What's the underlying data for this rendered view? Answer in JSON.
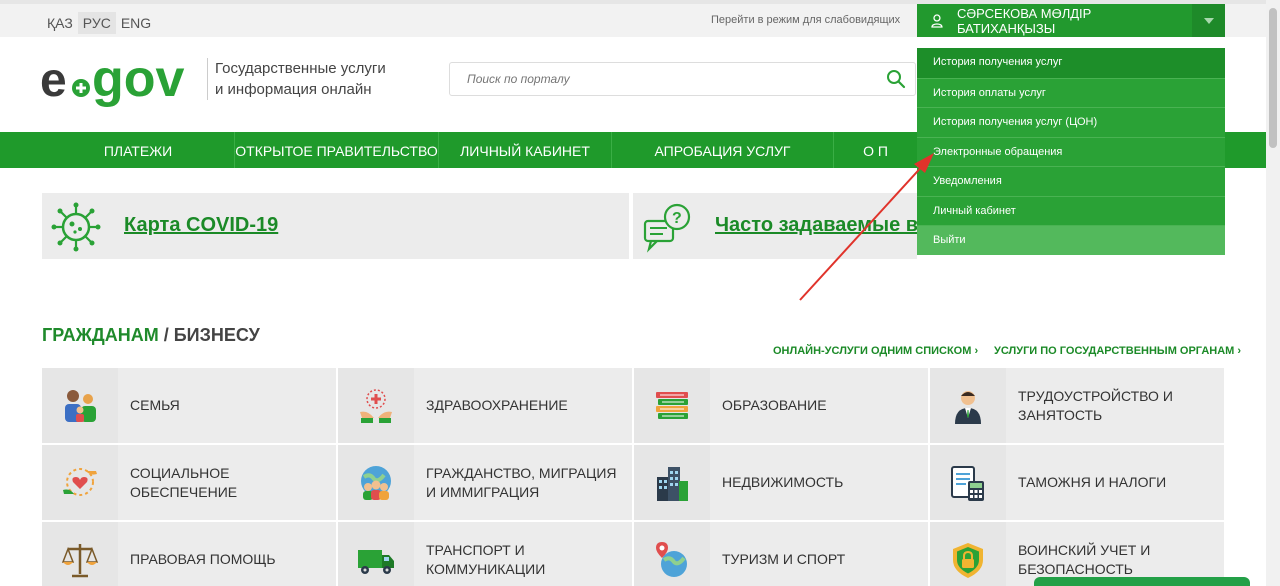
{
  "topbar": {
    "languages": [
      "ҚАЗ",
      "РУС",
      "ENG"
    ],
    "accessibility_link": "Перейти в режим для слабовидящих",
    "user_name": "СӘРСЕКОВА МӨЛДІР БАТИХАНҚЫЗЫ"
  },
  "header": {
    "logo_text": "egov",
    "tagline_line1": "Государственные услуги",
    "tagline_line2": "и информация онлайн",
    "search_placeholder": "Поиск по порталу"
  },
  "nav": {
    "items": [
      "ПЛАТЕЖИ",
      "ОТКРЫТОЕ ПРАВИТЕЛЬСТВО",
      "ЛИЧНЫЙ КАБИНЕТ",
      "АПРОБАЦИЯ УСЛУГ",
      "О П"
    ]
  },
  "banners": {
    "covid": "Карта COVID-19",
    "faq": "Часто задаваемые вопр"
  },
  "user_menu": {
    "items": [
      "История получения услуг",
      "История оплаты услуг",
      "История получения услуг (ЦОН)",
      "Электронные обращения",
      "Уведомления",
      "Личный кабинет",
      "Выйти"
    ]
  },
  "section": {
    "title_citizens": "ГРАЖДАНАМ",
    "title_sep": " / ",
    "title_business": "БИЗНЕСУ",
    "link_list": "ОНЛАЙН-УСЛУГИ ОДНИМ СПИСКОМ ›",
    "link_agencies": "УСЛУГИ ПО ГОСУДАРСТВЕННЫМ ОРГАНАМ ›"
  },
  "categories": [
    {
      "label": "Семья",
      "icon": "family-icon"
    },
    {
      "label": "Здравоохранение",
      "icon": "healthcare-icon"
    },
    {
      "label": "Образование",
      "icon": "books-icon"
    },
    {
      "label": "Трудоустройство и занятость",
      "icon": "worker-icon"
    },
    {
      "label": "Социальное обеспечение",
      "icon": "social-care-icon"
    },
    {
      "label": "Гражданство, миграция и иммиграция",
      "icon": "globe-people-icon"
    },
    {
      "label": "Недвижимость",
      "icon": "buildings-icon"
    },
    {
      "label": "Таможня и налоги",
      "icon": "calculator-icon"
    },
    {
      "label": "Правовая помощь",
      "icon": "scales-icon"
    },
    {
      "label": "Транспорт и коммуникации",
      "icon": "truck-icon"
    },
    {
      "label": "Туризм и спорт",
      "icon": "map-pin-globe-icon"
    },
    {
      "label": "Воинский учет и безопасность",
      "icon": "shield-lock-icon"
    }
  ],
  "colors": {
    "brand_green": "#1f9a2b",
    "annotation_arrow": "#e0332b"
  }
}
